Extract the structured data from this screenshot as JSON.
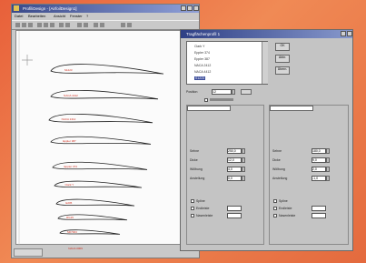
{
  "cad_window": {
    "title": "ProfiliDesign - [AirfoilDesign1]",
    "menu": [
      "Datei",
      "Bearbeiten",
      "Ansicht",
      "Fenster",
      "?"
    ]
  },
  "dialog": {
    "title": "Tragflächenprofil 1",
    "list_items": [
      "Clark Y",
      "Eppler 374",
      "Eppler 387",
      "NACA 2412",
      "NACA 4412",
      "S1223"
    ],
    "selected_index": 5,
    "buttons": {
      "ok": "OK",
      "cancel": "Abbr.",
      "apply": "Übern."
    },
    "left_fields": [
      {
        "label": "Sehne",
        "value": "250,0"
      },
      {
        "label": "Dicke",
        "value": "12,0"
      },
      {
        "label": "Wölbung",
        "value": "4,0"
      },
      {
        "label": "Anstellung",
        "value": "0,0"
      }
    ],
    "right_fields": [
      {
        "label": "Sehne",
        "value": "180,0"
      },
      {
        "label": "Dicke",
        "value": "9,0"
      },
      {
        "label": "Wölbung",
        "value": "2,0"
      },
      {
        "label": "Anstellung",
        "value": "-1,0"
      }
    ],
    "left_options": [
      "Spline",
      "Endleiste",
      "Nasenleiste"
    ],
    "right_options": [
      "Spline",
      "Endleiste",
      "Nasenleiste"
    ],
    "position_field": {
      "label": "Position",
      "value": "12"
    }
  },
  "airfoils": [
    {
      "label": "S1223"
    },
    {
      "label": "NACA 4412"
    },
    {
      "label": "NACA 2412"
    },
    {
      "label": "Eppler 387"
    },
    {
      "label": "Eppler 374"
    },
    {
      "label": "Clark Y"
    },
    {
      "label": "E205"
    },
    {
      "label": "RG15"
    },
    {
      "label": "SD7003"
    },
    {
      "label": "NACA 0009"
    }
  ]
}
